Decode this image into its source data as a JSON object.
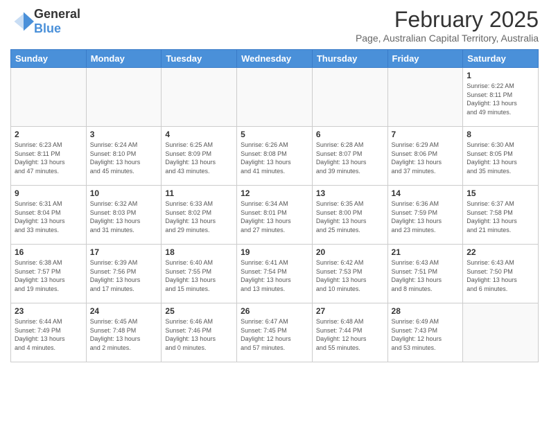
{
  "header": {
    "logo_general": "General",
    "logo_blue": "Blue",
    "month_title": "February 2025",
    "location": "Page, Australian Capital Territory, Australia"
  },
  "days_of_week": [
    "Sunday",
    "Monday",
    "Tuesday",
    "Wednesday",
    "Thursday",
    "Friday",
    "Saturday"
  ],
  "weeks": [
    [
      {
        "day": "",
        "info": ""
      },
      {
        "day": "",
        "info": ""
      },
      {
        "day": "",
        "info": ""
      },
      {
        "day": "",
        "info": ""
      },
      {
        "day": "",
        "info": ""
      },
      {
        "day": "",
        "info": ""
      },
      {
        "day": "1",
        "info": "Sunrise: 6:22 AM\nSunset: 8:11 PM\nDaylight: 13 hours\nand 49 minutes."
      }
    ],
    [
      {
        "day": "2",
        "info": "Sunrise: 6:23 AM\nSunset: 8:11 PM\nDaylight: 13 hours\nand 47 minutes."
      },
      {
        "day": "3",
        "info": "Sunrise: 6:24 AM\nSunset: 8:10 PM\nDaylight: 13 hours\nand 45 minutes."
      },
      {
        "day": "4",
        "info": "Sunrise: 6:25 AM\nSunset: 8:09 PM\nDaylight: 13 hours\nand 43 minutes."
      },
      {
        "day": "5",
        "info": "Sunrise: 6:26 AM\nSunset: 8:08 PM\nDaylight: 13 hours\nand 41 minutes."
      },
      {
        "day": "6",
        "info": "Sunrise: 6:28 AM\nSunset: 8:07 PM\nDaylight: 13 hours\nand 39 minutes."
      },
      {
        "day": "7",
        "info": "Sunrise: 6:29 AM\nSunset: 8:06 PM\nDaylight: 13 hours\nand 37 minutes."
      },
      {
        "day": "8",
        "info": "Sunrise: 6:30 AM\nSunset: 8:05 PM\nDaylight: 13 hours\nand 35 minutes."
      }
    ],
    [
      {
        "day": "9",
        "info": "Sunrise: 6:31 AM\nSunset: 8:04 PM\nDaylight: 13 hours\nand 33 minutes."
      },
      {
        "day": "10",
        "info": "Sunrise: 6:32 AM\nSunset: 8:03 PM\nDaylight: 13 hours\nand 31 minutes."
      },
      {
        "day": "11",
        "info": "Sunrise: 6:33 AM\nSunset: 8:02 PM\nDaylight: 13 hours\nand 29 minutes."
      },
      {
        "day": "12",
        "info": "Sunrise: 6:34 AM\nSunset: 8:01 PM\nDaylight: 13 hours\nand 27 minutes."
      },
      {
        "day": "13",
        "info": "Sunrise: 6:35 AM\nSunset: 8:00 PM\nDaylight: 13 hours\nand 25 minutes."
      },
      {
        "day": "14",
        "info": "Sunrise: 6:36 AM\nSunset: 7:59 PM\nDaylight: 13 hours\nand 23 minutes."
      },
      {
        "day": "15",
        "info": "Sunrise: 6:37 AM\nSunset: 7:58 PM\nDaylight: 13 hours\nand 21 minutes."
      }
    ],
    [
      {
        "day": "16",
        "info": "Sunrise: 6:38 AM\nSunset: 7:57 PM\nDaylight: 13 hours\nand 19 minutes."
      },
      {
        "day": "17",
        "info": "Sunrise: 6:39 AM\nSunset: 7:56 PM\nDaylight: 13 hours\nand 17 minutes."
      },
      {
        "day": "18",
        "info": "Sunrise: 6:40 AM\nSunset: 7:55 PM\nDaylight: 13 hours\nand 15 minutes."
      },
      {
        "day": "19",
        "info": "Sunrise: 6:41 AM\nSunset: 7:54 PM\nDaylight: 13 hours\nand 13 minutes."
      },
      {
        "day": "20",
        "info": "Sunrise: 6:42 AM\nSunset: 7:53 PM\nDaylight: 13 hours\nand 10 minutes."
      },
      {
        "day": "21",
        "info": "Sunrise: 6:43 AM\nSunset: 7:51 PM\nDaylight: 13 hours\nand 8 minutes."
      },
      {
        "day": "22",
        "info": "Sunrise: 6:43 AM\nSunset: 7:50 PM\nDaylight: 13 hours\nand 6 minutes."
      }
    ],
    [
      {
        "day": "23",
        "info": "Sunrise: 6:44 AM\nSunset: 7:49 PM\nDaylight: 13 hours\nand 4 minutes."
      },
      {
        "day": "24",
        "info": "Sunrise: 6:45 AM\nSunset: 7:48 PM\nDaylight: 13 hours\nand 2 minutes."
      },
      {
        "day": "25",
        "info": "Sunrise: 6:46 AM\nSunset: 7:46 PM\nDaylight: 13 hours\nand 0 minutes."
      },
      {
        "day": "26",
        "info": "Sunrise: 6:47 AM\nSunset: 7:45 PM\nDaylight: 12 hours\nand 57 minutes."
      },
      {
        "day": "27",
        "info": "Sunrise: 6:48 AM\nSunset: 7:44 PM\nDaylight: 12 hours\nand 55 minutes."
      },
      {
        "day": "28",
        "info": "Sunrise: 6:49 AM\nSunset: 7:43 PM\nDaylight: 12 hours\nand 53 minutes."
      },
      {
        "day": "",
        "info": ""
      }
    ]
  ]
}
